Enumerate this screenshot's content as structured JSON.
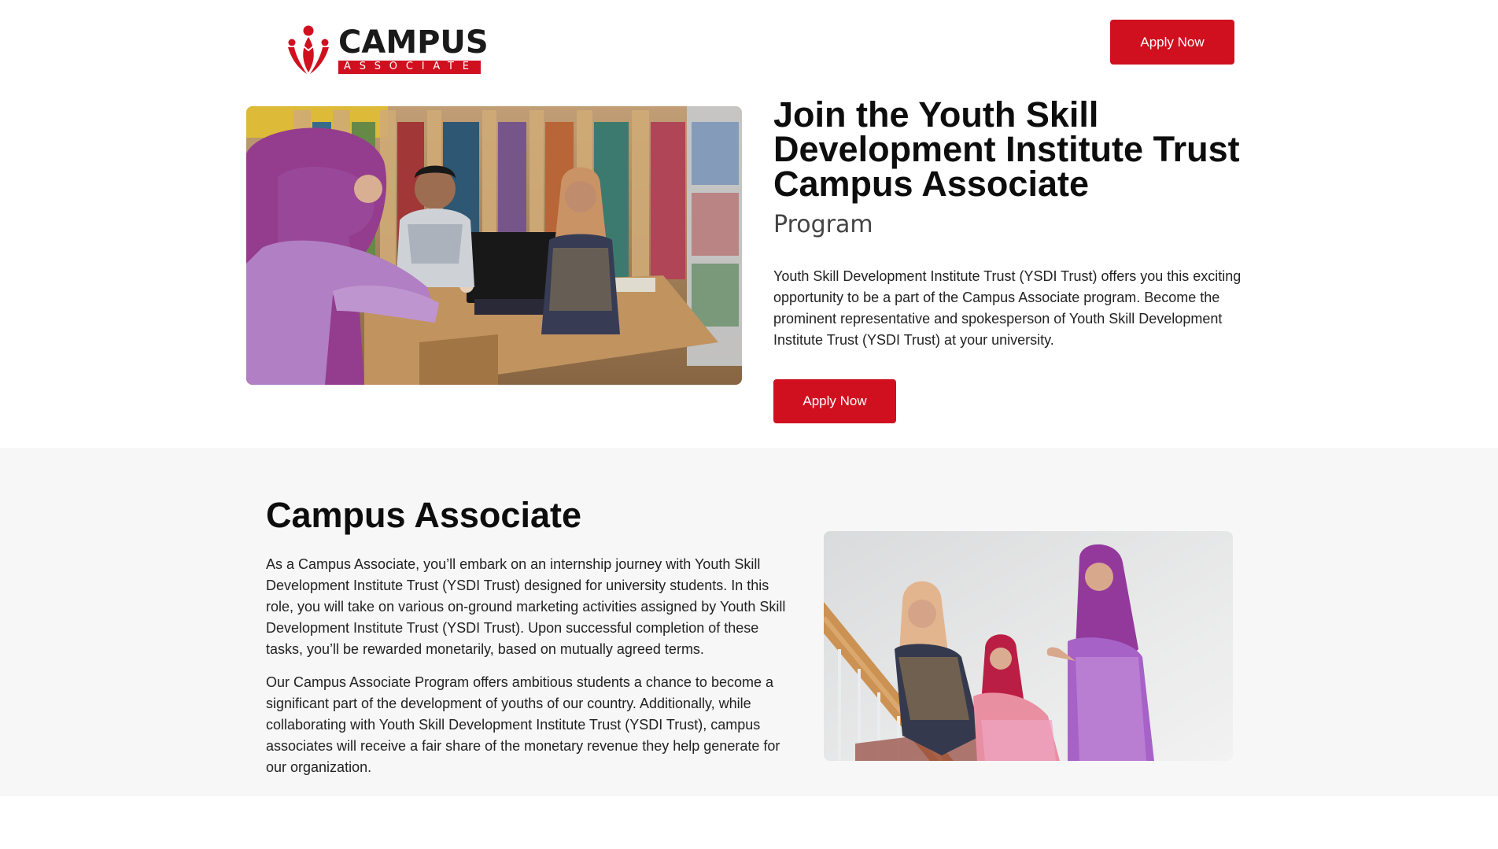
{
  "header": {
    "logo": {
      "word": "CAMPUS",
      "sub": "ASSOCIATE"
    },
    "apply_label": "Apply Now"
  },
  "hero": {
    "title": "Join the Youth Skill Development Institute Trust Campus Associate",
    "subtitle": "Program",
    "text": "Youth Skill Development Institute Trust (YSDI Trust) offers you this exciting opportunity to be a part of the Campus Associate program. Become the prominent representative and spokesperson of Youth Skill Development Institute Trust (YSDI Trust) at your university.",
    "apply_label": "Apply Now"
  },
  "about": {
    "title": "Campus Associate",
    "paragraph_1": "As a Campus Associate, you’ll embark on an internship journey with Youth Skill Development Institute Trust (YSDI Trust) designed for university students. In this role, you will take on various on-ground marketing activities assigned by Youth Skill Development Institute Trust (YSDI Trust). Upon successful completion of these tasks, you’ll be rewarded monetarily, based on mutually agreed terms.",
    "paragraph_2": "Our Campus Associate Program offers ambitious students a chance to become a significant part of the development of youths of our country. Additionally, while collaborating with Youth Skill Development Institute Trust (YSDI Trust), campus associates will receive a fair share of the monetary revenue they help generate for our organization."
  },
  "colors": {
    "brand_red": "#d0101f",
    "section_bg": "#f7f7f7",
    "heading": "#0d0d0d"
  }
}
